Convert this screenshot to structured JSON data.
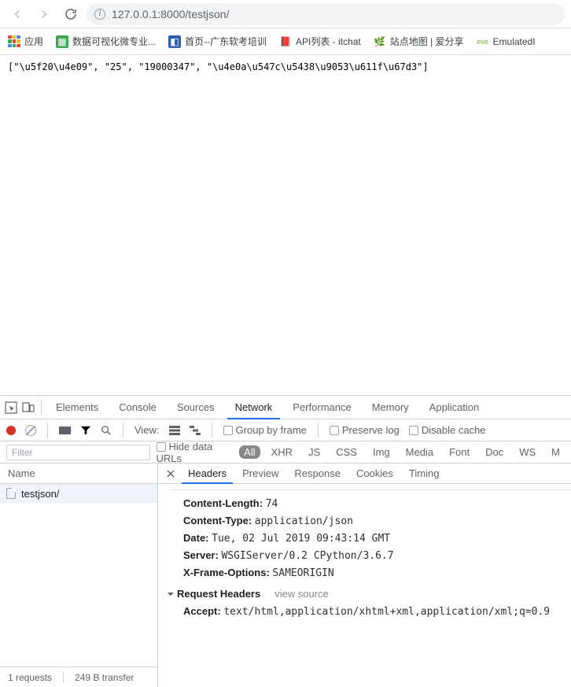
{
  "toolbar": {
    "url": "127.0.0.1:8000/testjson/"
  },
  "bookmarks": {
    "apps": "应用",
    "items": [
      {
        "label": "数据可视化微专业..."
      },
      {
        "label": "首页--广东软考培训"
      },
      {
        "label": "API列表 - itchat"
      },
      {
        "label": "站点地图 | 爱分享"
      },
      {
        "label": "EmulatedI"
      }
    ]
  },
  "page": {
    "body": "[\"\\u5f20\\u4e09\", \"25\", \"19000347\", \"\\u4e0a\\u547c\\u5438\\u9053\\u611f\\u67d3\"]"
  },
  "devtools": {
    "tabs": [
      "Elements",
      "Console",
      "Sources",
      "Network",
      "Performance",
      "Memory",
      "Application"
    ],
    "controls": {
      "view": "View:",
      "group": "Group by frame",
      "preserve": "Preserve log",
      "disable": "Disable cache"
    },
    "filter": {
      "placeholder": "Filter",
      "hide": "Hide data URLs",
      "types": [
        "All",
        "XHR",
        "JS",
        "CSS",
        "Img",
        "Media",
        "Font",
        "Doc",
        "WS",
        "M"
      ]
    },
    "list": {
      "header": "Name",
      "row": "testjson/"
    },
    "status": {
      "requests": "1 requests",
      "transfer": "249 B transfer"
    },
    "detailTabs": [
      "Headers",
      "Preview",
      "Response",
      "Cookies",
      "Timing"
    ],
    "headers": {
      "response": [
        {
          "name": "Content-Length:",
          "value": "74"
        },
        {
          "name": "Content-Type:",
          "value": "application/json"
        },
        {
          "name": "Date:",
          "value": "Tue, 02 Jul 2019 09:43:14 GMT"
        },
        {
          "name": "Server:",
          "value": "WSGIServer/0.2 CPython/3.6.7"
        },
        {
          "name": "X-Frame-Options:",
          "value": "SAMEORIGIN"
        }
      ],
      "reqSection": "Request Headers",
      "viewSource": "view source",
      "request": [
        {
          "name": "Accept:",
          "value": "text/html,application/xhtml+xml,application/xml;q=0.9"
        }
      ]
    }
  }
}
